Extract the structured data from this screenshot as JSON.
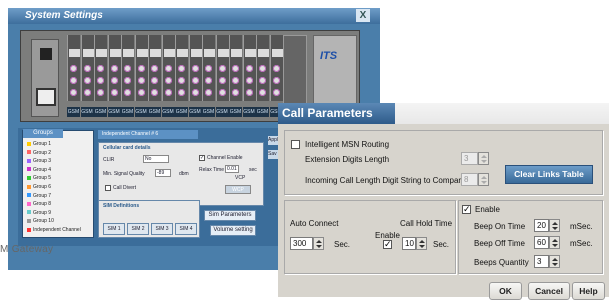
{
  "system_window": {
    "title": "System Settings",
    "close_glyph": "X",
    "chassis": {
      "cards": [
        {
          "label": "Ant 1",
          "slot": "GSM"
        },
        {
          "label": "Ant 1",
          "slot": "GSM"
        },
        {
          "label": "Ant 1",
          "slot": "GSM"
        },
        {
          "label": "Ant 1",
          "slot": "GSM"
        },
        {
          "label": "Ant 1",
          "slot": "GSM"
        },
        {
          "label": "Ant 1",
          "slot": "GSM"
        },
        {
          "label": "Ant 1",
          "slot": "GSM"
        },
        {
          "label": "Ant 1",
          "slot": "GSM"
        },
        {
          "label": "Ant 1",
          "slot": "GSM"
        },
        {
          "label": "Ant 1",
          "slot": "GSM"
        },
        {
          "label": "Ant 1",
          "slot": "GSM"
        },
        {
          "label": "Ant 1",
          "slot": "GSM"
        },
        {
          "label": "Ant 1",
          "slot": "GSM"
        },
        {
          "label": "Ant 1",
          "slot": "GSM"
        },
        {
          "label": "Ant 1",
          "slot": "GSM"
        },
        {
          "label": "Ant 1",
          "slot": "GSM"
        }
      ],
      "logo": "ITS"
    },
    "groups_tab": "Groups",
    "groups": [
      {
        "label": "Group 1",
        "color": "#ffcc00"
      },
      {
        "label": "Group 2",
        "color": "#ff6666"
      },
      {
        "label": "Group 3",
        "color": "#9966ff"
      },
      {
        "label": "Group 4",
        "color": "#cc33cc"
      },
      {
        "label": "Group 5",
        "color": "#33cc33"
      },
      {
        "label": "Group 6",
        "color": "#ff9933"
      },
      {
        "label": "Group 7",
        "color": "#3399ff"
      },
      {
        "label": "Group 8",
        "color": "#ff66cc"
      },
      {
        "label": "Group 9",
        "color": "#66cccc"
      },
      {
        "label": "Group 10",
        "color": "#999999"
      },
      {
        "label": "Independent Channel",
        "color": "#ff3333"
      }
    ],
    "channel_tab": "Independent Channel # 6",
    "cellular_box_title": "Cellular card details",
    "clir_label": "CLIR",
    "clir_value": "No",
    "channel_enable_label": "Channel Enable",
    "min_signal_label": "Min. Signal Quality",
    "min_signal_value": "-89",
    "min_signal_unit": "dbm",
    "relax_time_label": "Relax Time",
    "relax_time_value": "0.01",
    "relax_time_unit": "sec",
    "vcp_label": "VCP",
    "call_divert_label": "Call Divert",
    "wcp_button": "WCP",
    "sim_box_title": "SIM Definitions",
    "sim_buttons": [
      "SIM 1",
      "SIM 2",
      "SIM 3",
      "SIM 4"
    ],
    "sim_parameters_button": "Sim Parameters",
    "volume_setting_button": "Volume setting",
    "apply_fragment": "Appl",
    "save_fragment": "Sav",
    "gateway_fragment": "M Gateway"
  },
  "dialog": {
    "title": "Call Parameters",
    "intelligent_msn": {
      "label": "Intelligent MSN Routing",
      "checked": false
    },
    "extension_digits": {
      "label": "Extension Digits Length",
      "value": "3"
    },
    "incoming_digits": {
      "label": "Incoming Call Length Digit String to Compare",
      "value": "8"
    },
    "clear_links_button": "Clear Links Table",
    "auto_connect": {
      "label": "Auto Connect",
      "value": "300",
      "unit": "Sec."
    },
    "call_hold": {
      "label": "Call Hold Time",
      "enable_label": "Enable",
      "enabled": true,
      "value": "10",
      "unit": "Sec."
    },
    "beep": {
      "enable_label": "Enable",
      "enabled": true,
      "on_label": "Beep On Time",
      "on_value": "20",
      "on_unit": "mSec.",
      "off_label": "Beep Off Time",
      "off_value": "60",
      "off_unit": "mSec.",
      "qty_label": "Beeps Quantity",
      "qty_value": "3"
    },
    "ok_button": "OK",
    "cancel_button": "Cancel",
    "help_button": "Help"
  }
}
